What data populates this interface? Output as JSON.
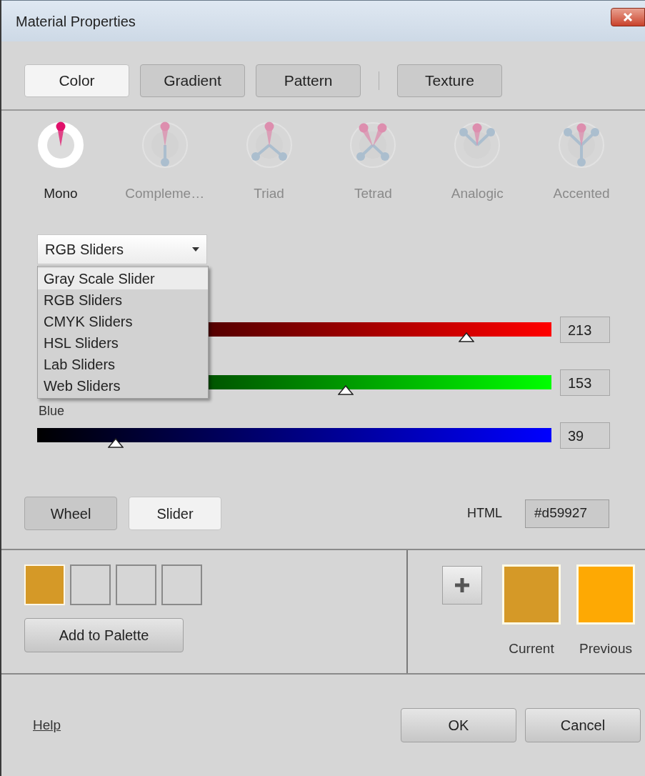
{
  "window": {
    "title": "Material Properties"
  },
  "tabs": [
    {
      "label": "Color",
      "selected": true,
      "separator_before": false
    },
    {
      "label": "Gradient",
      "selected": false,
      "separator_before": false
    },
    {
      "label": "Pattern",
      "selected": false,
      "separator_before": false
    },
    {
      "label": "Texture",
      "selected": false,
      "separator_before": true
    }
  ],
  "harmonies": [
    {
      "kind": "mono",
      "label": "Mono",
      "selected": true
    },
    {
      "kind": "complementary",
      "label": "Compleme…",
      "selected": false
    },
    {
      "kind": "triad",
      "label": "Triad",
      "selected": false
    },
    {
      "kind": "tetrad",
      "label": "Tetrad",
      "selected": false
    },
    {
      "kind": "analogic",
      "label": "Analogic",
      "selected": false
    },
    {
      "kind": "accented",
      "label": "Accented",
      "selected": false
    }
  ],
  "slider_mode": {
    "value": "RGB Sliders",
    "expanded": true,
    "options": [
      {
        "label": "Gray Scale Slider",
        "highlighted": true
      },
      {
        "label": "RGB Sliders",
        "highlighted": false
      },
      {
        "label": "CMYK Sliders",
        "highlighted": false
      },
      {
        "label": "HSL Sliders",
        "highlighted": false
      },
      {
        "label": "Lab Sliders",
        "highlighted": false
      },
      {
        "label": "Web Sliders",
        "highlighted": false
      }
    ]
  },
  "sliders": [
    {
      "color": "#ff0000",
      "level": 0.835,
      "value": "213"
    },
    {
      "color": "#00ff00",
      "level": 0.6,
      "value": "153"
    },
    {
      "label": "Blue",
      "color": "#0000ff",
      "level": 0.153,
      "value": "39"
    }
  ],
  "view_buttons": [
    {
      "label": "Wheel",
      "selected": false
    },
    {
      "label": "Slider",
      "selected": true
    }
  ],
  "html": {
    "label": "HTML",
    "value": "#d59927"
  },
  "palette": {
    "swatches": [
      {
        "filled": true,
        "color": "#d59927"
      },
      {
        "filled": false
      },
      {
        "filled": false
      },
      {
        "filled": false
      }
    ],
    "button": "Add to Palette"
  },
  "current": {
    "label": "Current",
    "color": "#d59927"
  },
  "previous": {
    "label": "Previous",
    "color": "#fea903"
  },
  "footer": {
    "help": "Help",
    "buttons": [
      "OK",
      "Cancel"
    ]
  }
}
